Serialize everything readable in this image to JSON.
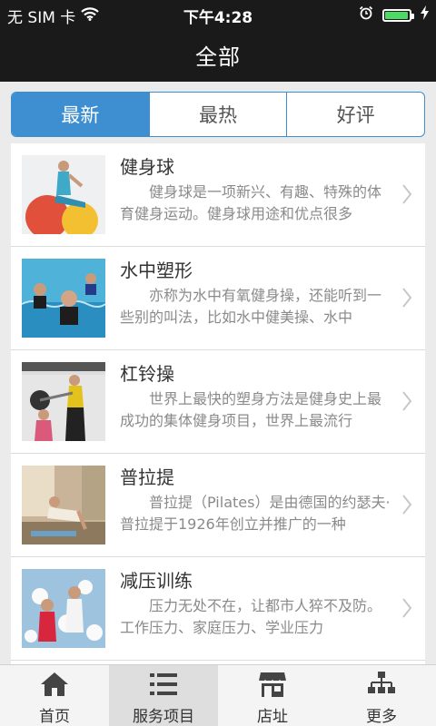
{
  "status_bar": {
    "carrier": "无 SIM 卡",
    "time": "下午4:28",
    "battery_level": 0.95,
    "icons": [
      "wifi-icon",
      "alarm-icon",
      "battery-icon",
      "charging-icon"
    ]
  },
  "nav": {
    "title": "全部"
  },
  "segments": [
    {
      "label": "最新",
      "active": true
    },
    {
      "label": "最热",
      "active": false
    },
    {
      "label": "好评",
      "active": false
    }
  ],
  "items": [
    {
      "title": "健身球",
      "desc": "健身球是一项新兴、有趣、特殊的体育健身运动。健身球用途和优点很多",
      "image": "gym-ball-photo"
    },
    {
      "title": "水中塑形",
      "desc": "亦称为水中有氧健身操，还能听到一些别的叫法，比如水中健美操、水中",
      "image": "water-aerobics-photo"
    },
    {
      "title": "杠铃操",
      "desc": "世界上最快的塑身方法是健身史上最成功的集体健身项目，世界上最流行",
      "image": "barbell-workout-photo"
    },
    {
      "title": "普拉提",
      "desc": "普拉提（Pilates）是由德国的约瑟夫·普拉提于1926年创立并推广的一种",
      "image": "pilates-photo"
    },
    {
      "title": "减压训练",
      "desc": "压力无处不在，让都市人猝不及防。工作压力、家庭压力、学业压力",
      "image": "stress-relief-photo"
    }
  ],
  "tabbar": [
    {
      "label": "首页",
      "icon": "home-icon",
      "active": false
    },
    {
      "label": "服务项目",
      "icon": "list-icon",
      "active": true
    },
    {
      "label": "店址",
      "icon": "store-icon",
      "active": false
    },
    {
      "label": "更多",
      "icon": "sitemap-icon",
      "active": false
    }
  ],
  "colors": {
    "accent": "#3d8fd1",
    "bar_bg": "#1a1a1a",
    "page_bg": "#ebebeb",
    "battery": "#4cd964"
  }
}
